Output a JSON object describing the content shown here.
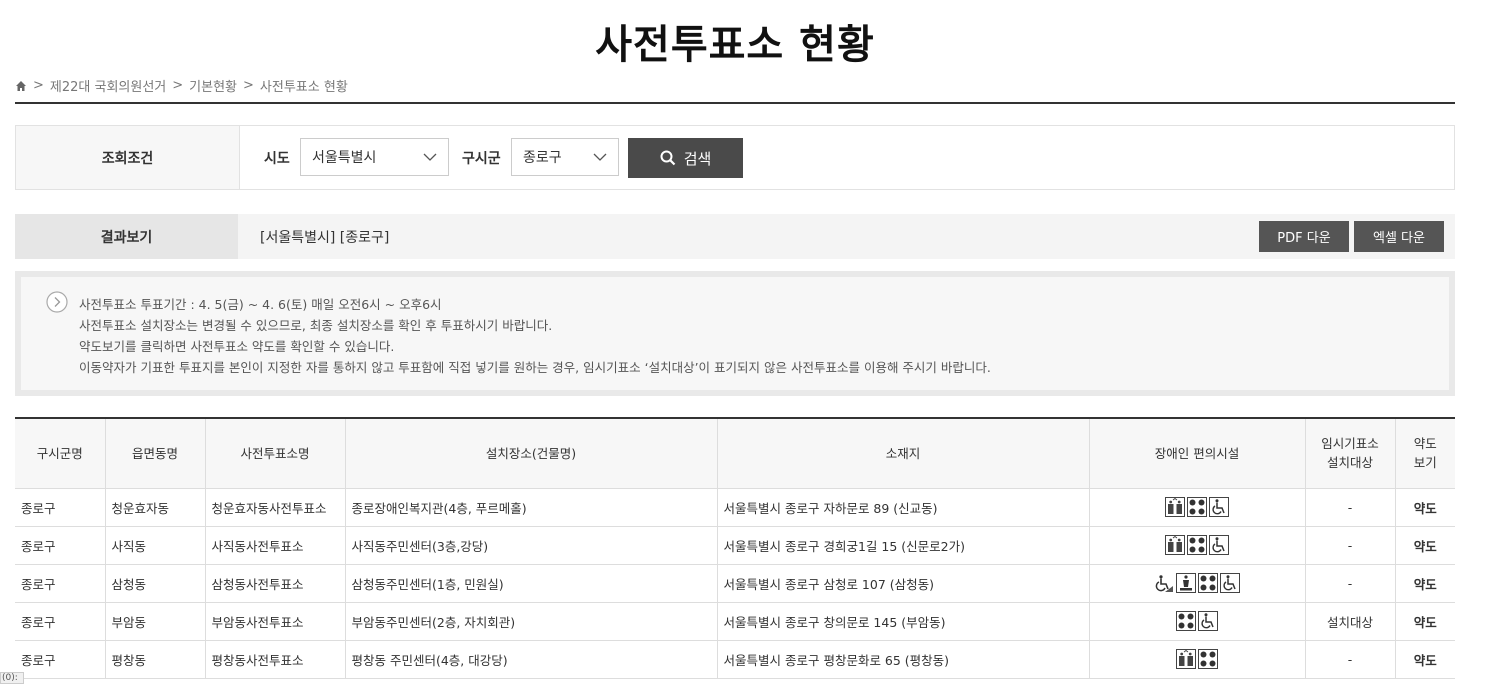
{
  "page": {
    "title": "사전투표소 현황"
  },
  "breadcrumb": [
    "제22대 국회의원선거",
    "기본현황",
    "사전투표소 현황"
  ],
  "search": {
    "label": "조회조건",
    "sido_label": "시도",
    "sido_value": "서울특별시",
    "gu_label": "구시군",
    "gu_value": "종로구",
    "button": "검색"
  },
  "result": {
    "label": "결과보기",
    "text": "[서울특별시] [종로구]",
    "pdf_button": "PDF 다운",
    "excel_button": "엑셀 다운"
  },
  "notice": {
    "lines": [
      "사전투표소 투표기간 : 4. 5(금) ~ 4. 6(토) 매일 오전6시 ~ 오후6시",
      "사전투표소 설치장소는 변경될 수 있으므로, 최종 설치장소를 확인 후 투표하시기 바랍니다.",
      "약도보기를 클릭하면 사전투표소 약도를 확인할 수 있습니다.",
      "이동약자가 기표한 투표지를 본인이 지정한 자를 통하지 않고 투표함에 직접 넣기를 원하는 경우, 임시기표소 ‘설치대상’이 표기되지 않은 사전투표소를 이용해 주시기 바랍니다."
    ]
  },
  "table": {
    "headers": {
      "gu": "구시군명",
      "dong": "읍면동명",
      "station": "사전투표소명",
      "place": "설치장소(건물명)",
      "address": "소재지",
      "facility": "장애인 편의시설",
      "temp_1": "임시기표소",
      "temp_2": "설치대상",
      "map_1": "약도",
      "map_2": "보기"
    },
    "rows": [
      {
        "gu": "종로구",
        "dong": "청운효자동",
        "station": "청운효자동사전투표소",
        "place": "종로장애인복지관(4층, 푸르메홀)",
        "address": "서울특별시 종로구 자하문로 89 (신교동)",
        "facilities": [
          "elevator-icon",
          "braille-icon",
          "wheelchair-icon"
        ],
        "temp": "-",
        "map": "약도"
      },
      {
        "gu": "종로구",
        "dong": "사직동",
        "station": "사직동사전투표소",
        "place": "사직동주민센터(3층,강당)",
        "address": "서울특별시 종로구 경희궁1길 15 (신문로2가)",
        "facilities": [
          "elevator-icon",
          "braille-icon",
          "wheelchair-icon"
        ],
        "temp": "-",
        "map": "약도"
      },
      {
        "gu": "종로구",
        "dong": "삼청동",
        "station": "삼청동사전투표소",
        "place": "삼청동주민센터(1층, 민원실)",
        "address": "서울특별시 종로구 삼청로 107 (삼청동)",
        "facilities": [
          "ramp-icon",
          "lift-icon",
          "braille-icon",
          "wheelchair-icon"
        ],
        "temp": "-",
        "map": "약도"
      },
      {
        "gu": "종로구",
        "dong": "부암동",
        "station": "부암동사전투표소",
        "place": "부암동주민센터(2층, 자치회관)",
        "address": "서울특별시 종로구 창의문로 145 (부암동)",
        "facilities": [
          "braille-icon",
          "wheelchair-icon"
        ],
        "temp": "설치대상",
        "map": "약도"
      },
      {
        "gu": "종로구",
        "dong": "평창동",
        "station": "평창동사전투표소",
        "place": "평창동 주민센터(4층, 대강당)",
        "address": "서울특별시 종로구 평창문화로 65 (평창동)",
        "facilities": [
          "elevator-icon",
          "braille-icon"
        ],
        "temp": "-",
        "map": "약도"
      }
    ]
  },
  "corner_text": "(0):"
}
